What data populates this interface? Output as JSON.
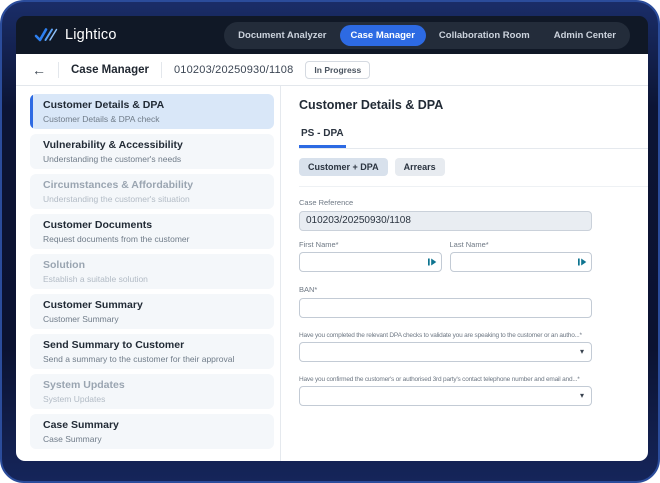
{
  "header": {
    "brand": "Lightico",
    "nav": [
      {
        "label": "Document Analyzer",
        "active": false
      },
      {
        "label": "Case Manager",
        "active": true
      },
      {
        "label": "Collaboration Room",
        "active": false
      },
      {
        "label": "Admin Center",
        "active": false
      }
    ]
  },
  "toolbar": {
    "back_icon": "←",
    "title": "Case Manager",
    "case_number": "010203/20250930/1108",
    "status": "In Progress"
  },
  "sidebar": {
    "items": [
      {
        "title": "Customer Details & DPA",
        "subtitle": "Customer Details & DPA check",
        "state": "active"
      },
      {
        "title": "Vulnerability & Accessibility",
        "subtitle": "Understanding the customer's needs",
        "state": "enabled"
      },
      {
        "title": "Circumstances & Affordability",
        "subtitle": "Understanding the customer's situation",
        "state": "disabled"
      },
      {
        "title": "Customer Documents",
        "subtitle": "Request documents from the customer",
        "state": "enabled"
      },
      {
        "title": "Solution",
        "subtitle": "Establish a suitable solution",
        "state": "disabled"
      },
      {
        "title": "Customer Summary",
        "subtitle": "Customer Summary",
        "state": "enabled"
      },
      {
        "title": "Send Summary to Customer",
        "subtitle": "Send a summary to the customer for their approval",
        "state": "enabled"
      },
      {
        "title": "System Updates",
        "subtitle": "System Updates",
        "state": "disabled"
      },
      {
        "title": "Case Summary",
        "subtitle": "Case Summary",
        "state": "enabled"
      }
    ]
  },
  "panel": {
    "title": "Customer Details & DPA",
    "tab": "PS - DPA",
    "chips": [
      {
        "label": "Customer + DPA",
        "selected": true
      },
      {
        "label": "Arrears",
        "selected": false
      }
    ],
    "fields": {
      "case_reference": {
        "label": "Case Reference",
        "value": "010203/20250930/1108"
      },
      "first_name": {
        "label": "First Name*",
        "value": ""
      },
      "last_name": {
        "label": "Last Name*",
        "value": ""
      },
      "ban": {
        "label": "BAN*",
        "value": ""
      },
      "dpa_check": {
        "label": "Have you completed the relevant DPA checks to validate you are speaking to the customer or an autho...*",
        "value": ""
      },
      "contact_check": {
        "label": "Have you confirmed the customer's or authorised 3rd party's contact telephone number and email and...*",
        "value": ""
      }
    }
  },
  "icons": {
    "dropdown_caret": "▾",
    "request_from_customer": "request-from-customer"
  },
  "colors": {
    "accent_blue": "#2d6ae3",
    "appbar_bg": "#101826",
    "frame_navy": "#0b1231",
    "active_item_bg": "#d9e7f8",
    "field_icon_teal": "#0e7490",
    "readonly_bg": "#e9edf2"
  }
}
